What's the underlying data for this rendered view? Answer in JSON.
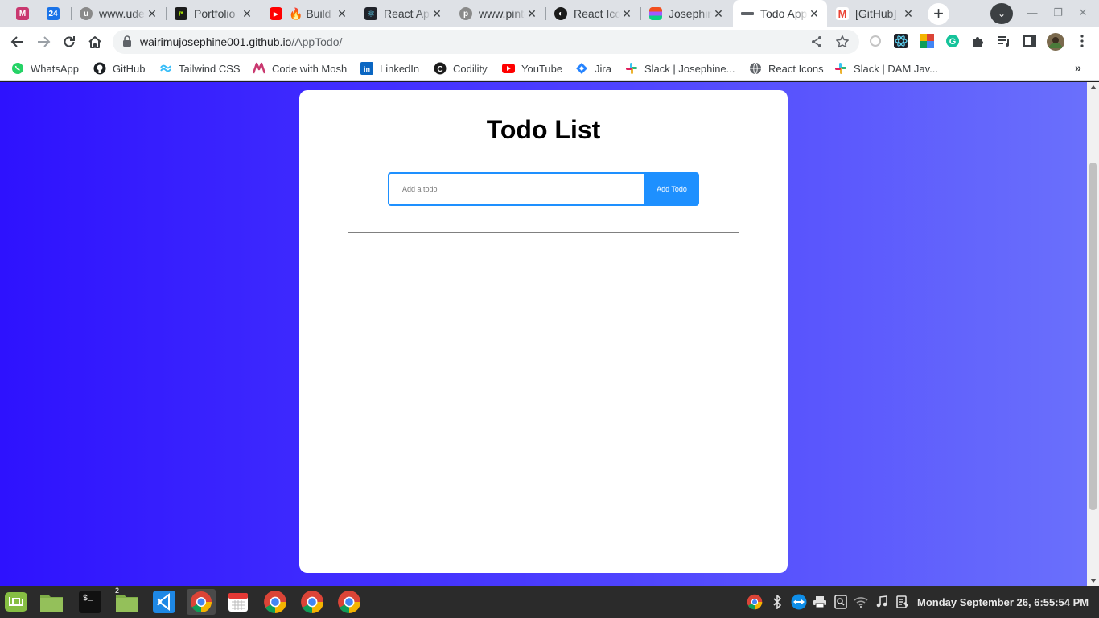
{
  "browser": {
    "tabs": [
      {
        "title": "",
        "icon": "dev-m-icon",
        "color": "#c9386f",
        "active": false
      },
      {
        "title": "",
        "icon": "calendar-icon",
        "color": "#1a73e8",
        "active": false
      },
      {
        "title": "www.udemy.com",
        "icon": "udemy-icon",
        "color": "#8a8a8a",
        "active": false
      },
      {
        "title": "Portfolio",
        "icon": "portfolio-icon",
        "color": "#1b1b1b",
        "active": false
      },
      {
        "title": "🔥 Build a",
        "icon": "youtube-icon",
        "color": "#ff0000",
        "active": false
      },
      {
        "title": "React App",
        "icon": "react-icon",
        "color": "#20232a",
        "active": false
      },
      {
        "title": "www.pinterest",
        "icon": "pinterest-icon",
        "color": "#8a8a8a",
        "active": false
      },
      {
        "title": "React Icons",
        "icon": "globe-icon",
        "color": "#1b1b1b",
        "active": false
      },
      {
        "title": "Josephine",
        "icon": "figma-icon",
        "color": "#a259ff",
        "active": false
      },
      {
        "title": "Todo App",
        "icon": "page-icon",
        "color": "#5f6368",
        "active": true
      },
      {
        "title": "[GitHub]",
        "icon": "gmail-icon",
        "color": "#ea4335",
        "active": false
      }
    ],
    "url_host": "wairimujosephine001.github.io",
    "url_path": "/AppTodo/",
    "bookmarks": [
      {
        "label": "WhatsApp",
        "icon": "whatsapp-icon",
        "color": "#25d366"
      },
      {
        "label": "GitHub",
        "icon": "github-icon",
        "color": "#1b1f23"
      },
      {
        "label": "Tailwind CSS",
        "icon": "tailwind-icon",
        "color": "#38bdf8"
      },
      {
        "label": "Code with Mosh",
        "icon": "mosh-icon",
        "color": "#c9386f"
      },
      {
        "label": "LinkedIn",
        "icon": "linkedin-icon",
        "color": "#0a66c2"
      },
      {
        "label": "Codility",
        "icon": "codility-icon",
        "color": "#1b1b1b"
      },
      {
        "label": "YouTube",
        "icon": "youtube-icon",
        "color": "#ff0000"
      },
      {
        "label": "Jira",
        "icon": "jira-icon",
        "color": "#2684ff"
      },
      {
        "label": "Slack | Josephine...",
        "icon": "slack-icon",
        "color": "#e01e5a"
      },
      {
        "label": "React Icons",
        "icon": "globe-icon",
        "color": "#5f6368"
      },
      {
        "label": "Slack | DAM Jav...",
        "icon": "slack-icon",
        "color": "#e01e5a"
      }
    ]
  },
  "page": {
    "title": "Todo List",
    "input_placeholder": "Add a todo",
    "input_value": "",
    "add_button_label": "Add Todo",
    "todos": [],
    "accent_color": "#1e90ff",
    "background_gradient": [
      "#2e12fe",
      "#6a70fc"
    ]
  },
  "taskbar": {
    "apps": [
      "mint-menu-icon",
      "files-icon",
      "terminal-icon",
      "files-icon",
      "vscode-icon",
      "chrome-icon",
      "calendar-icon",
      "chrome-icon",
      "chrome-icon",
      "chrome-icon"
    ],
    "files_badge": "2",
    "clock": "Monday September 26, 6:55:54 PM"
  }
}
